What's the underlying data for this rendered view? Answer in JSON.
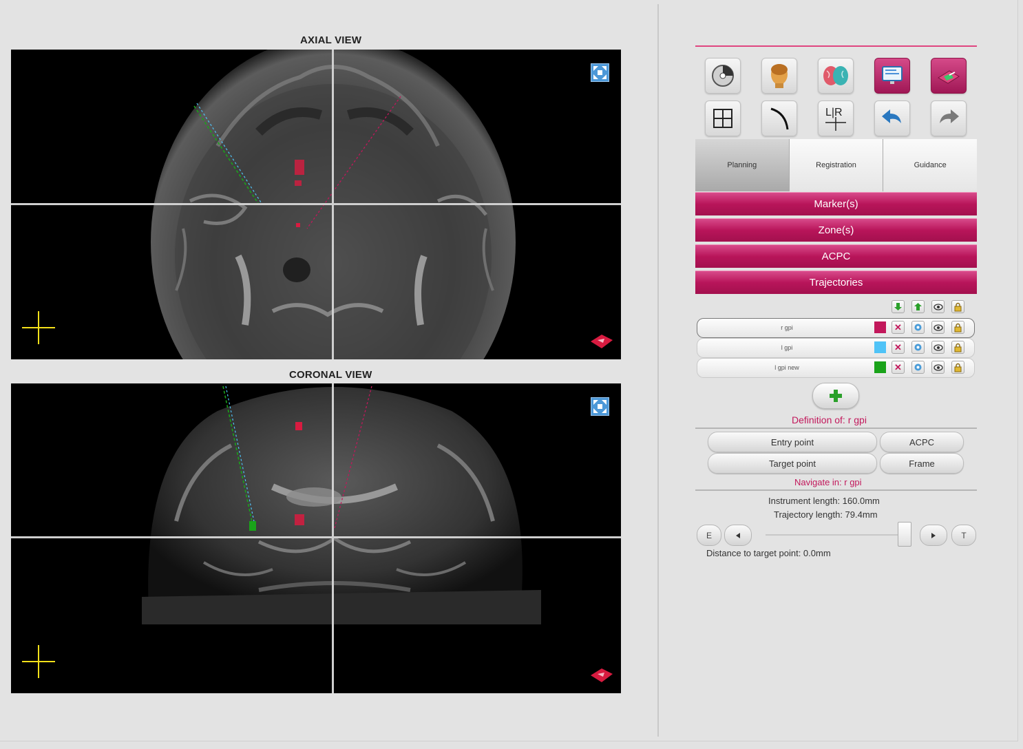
{
  "axial": {
    "title": "AXIAL VIEW"
  },
  "coronal": {
    "title": "CORONAL VIEW"
  },
  "toolbar": {
    "row1": [
      "disk-icon",
      "head-icon",
      "brain-icon",
      "monitor-icon",
      "stereotactic-frame-icon"
    ],
    "row2": [
      "layout-grid-icon",
      "curve-icon",
      "left-right-icon",
      "undo-icon",
      "redo-icon"
    ],
    "row2_lr_text": "L|R"
  },
  "tabs": [
    {
      "label": "Planning",
      "active": true
    },
    {
      "label": "Registration",
      "active": false
    },
    {
      "label": "Guidance",
      "active": false
    }
  ],
  "sections": [
    "Marker(s)",
    "Zone(s)",
    "ACPC",
    "Trajectories"
  ],
  "trajectories": [
    {
      "name": "r gpi",
      "color": "#c2185b",
      "selected": true
    },
    {
      "name": "l gpi",
      "color": "#4fc3f7",
      "selected": false
    },
    {
      "name": "l gpi new",
      "color": "#1aa31a",
      "selected": false
    }
  ],
  "definition": {
    "title": "Definition of: r gpi",
    "entry_point": "Entry point",
    "acpc": "ACPC",
    "target_point": "Target point",
    "frame": "Frame"
  },
  "navigate": {
    "title": "Navigate in: r gpi",
    "instrument_length": "Instrument length: 160.0mm",
    "trajectory_length": "Trajectory length: 79.4mm",
    "entry_btn": "E",
    "target_btn": "T",
    "distance": "Distance to target point: 0.0mm",
    "slider_position": 0.95
  },
  "colors": {
    "accent": "#c2185b",
    "green_trajectory": "#1aa31a",
    "blue_trajectory": "#4fc3f7",
    "red_trajectory": "#c2185b"
  }
}
